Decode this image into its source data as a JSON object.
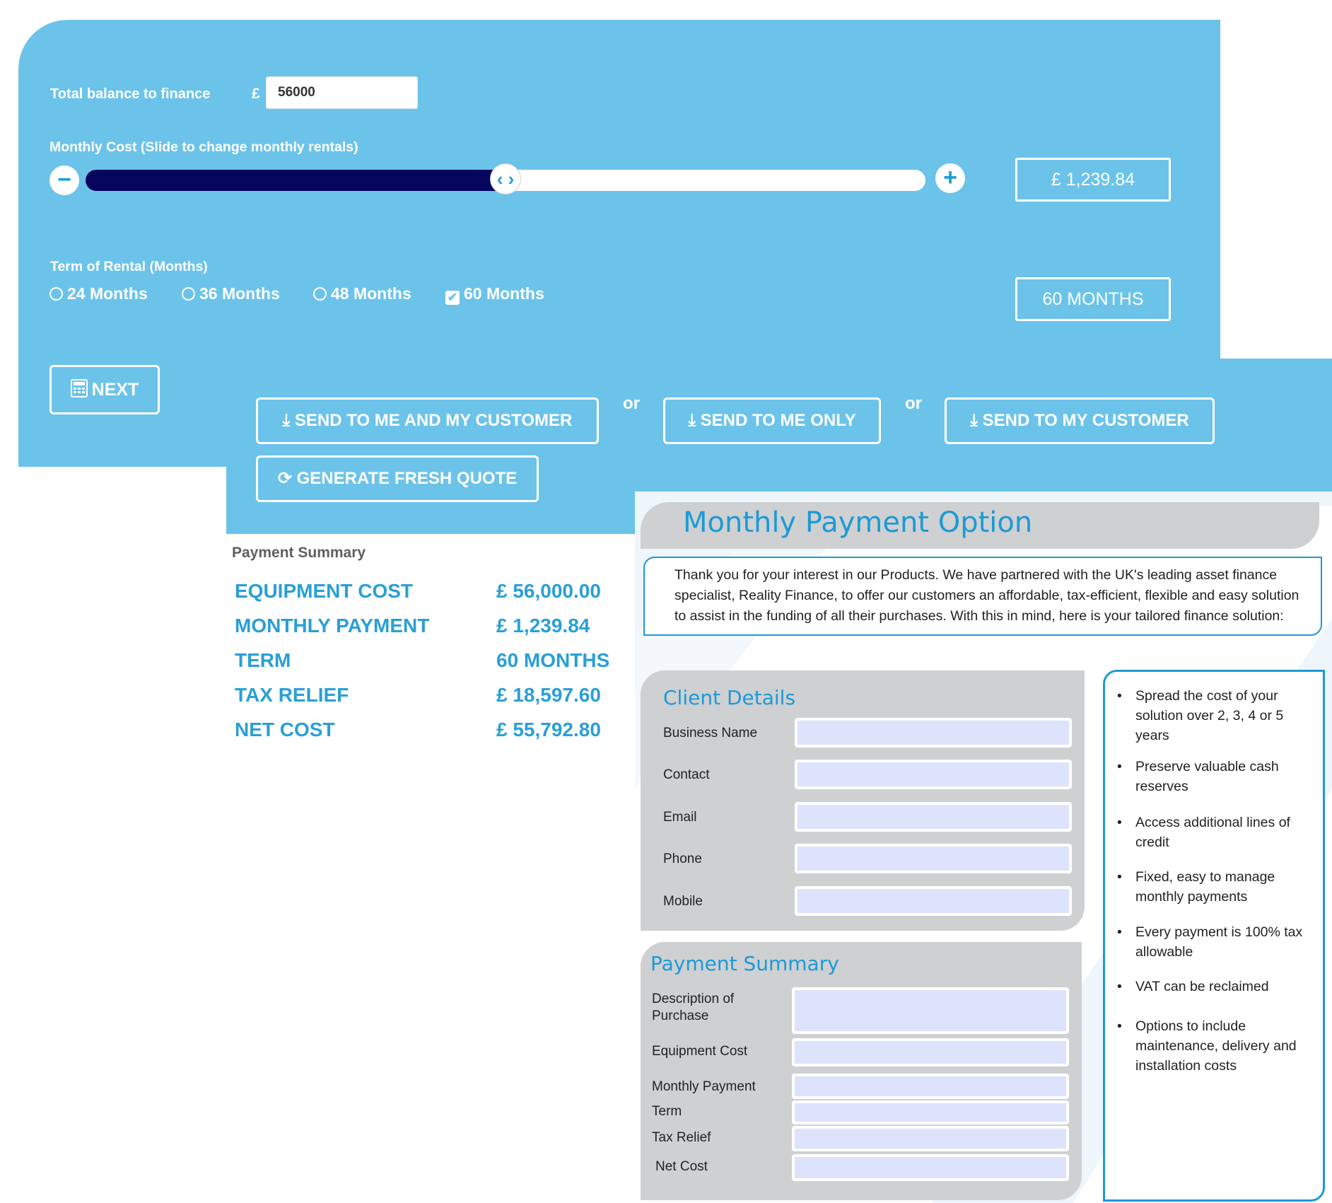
{
  "calculator": {
    "balance_label": "Total balance to finance",
    "currency_symbol": "£",
    "balance_value": "56000",
    "monthly_label": "Monthly Cost (Slide to change monthly rentals)",
    "slider_minus": "−",
    "slider_plus": "+",
    "slider_thumb": "‹ ›",
    "slider_level_fraction": 0.5,
    "monthly_cost_display": "£ 1,239.84",
    "term_label": "Term of Rental (Months)",
    "term_options": [
      {
        "label": "24 Months",
        "selected": false
      },
      {
        "label": "36 Months",
        "selected": false
      },
      {
        "label": "48 Months",
        "selected": false
      },
      {
        "label": "60 Months",
        "selected": true
      }
    ],
    "term_display": "60 MONTHS",
    "next_label": "NEXT",
    "next_icon": "calculator-icon"
  },
  "send": {
    "send_both_label": "SEND TO ME AND MY CUSTOMER",
    "or_text": "or",
    "send_me_label": "SEND TO ME ONLY",
    "send_customer_label": "SEND TO MY CUSTOMER",
    "generate_label": "GENERATE FRESH QUOTE",
    "download_icon": "download-icon",
    "refresh_icon": "refresh-icon"
  },
  "summary": {
    "title": "Payment Summary",
    "rows": [
      {
        "label": "EQUIPMENT COST",
        "value": "£ 56,000.00"
      },
      {
        "label": "MONTHLY PAYMENT",
        "value": "£ 1,239.84"
      },
      {
        "label": "TERM",
        "value": "60 MONTHS"
      },
      {
        "label": "TAX RELIEF",
        "value": "£ 18,597.60"
      },
      {
        "label": "NET COST",
        "value": "£ 55,792.80"
      }
    ]
  },
  "brochure": {
    "title": "Monthly Payment Option",
    "intro": "Thank you for your interest in our Products. We have partnered with the UK's leading asset finance specialist, Reality Finance, to offer our customers an affordable, tax-efficient, flexible and easy solution to assist in the funding of all their purchases. With this in mind, here is your tailored finance solution:",
    "client_title": "Client Details",
    "client_fields": [
      "Business Name",
      "Contact",
      "Email",
      "Phone",
      "Mobile"
    ],
    "payment_title": "Payment Summary",
    "payment_fields": [
      "Description of Purchase",
      "Equipment Cost",
      "Monthly Payment",
      "Term",
      "Tax Relief",
      "Net Cost"
    ],
    "benefits": [
      "Spread the cost of your solution over 2, 3, 4 or 5 years",
      "Preserve valuable cash reserves",
      "Access additional lines of credit",
      "Fixed, easy to manage monthly payments",
      "Every payment is 100% tax allowable",
      "VAT can be reclaimed",
      "Options to include maintenance, delivery and installation costs"
    ]
  },
  "colors": {
    "panel_blue": "#6cc3ea",
    "slider_fill": "#06055e",
    "accent_blue": "#2a9fd6",
    "brochure_gray": "#cfd0d2",
    "field_fill": "#dce3fb"
  }
}
